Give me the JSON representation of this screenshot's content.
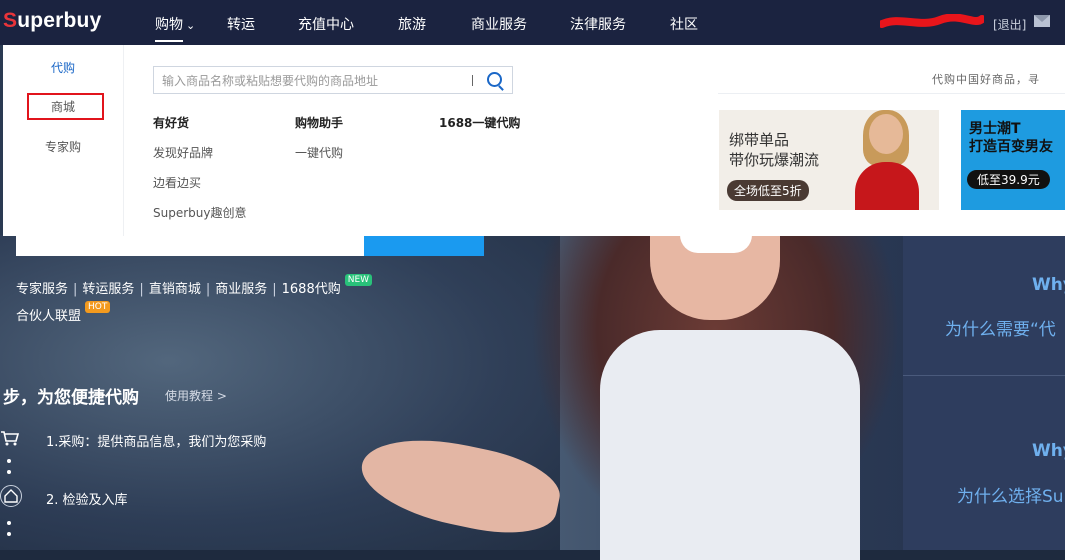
{
  "header": {
    "logo_s": "S",
    "logo_rest": "uperbuy",
    "nav": [
      "购物",
      "转运",
      "充值中心",
      "旅游",
      "商业服务",
      "法律服务",
      "社区"
    ],
    "logout": "[退出]"
  },
  "dropdown": {
    "side_items": [
      "代购",
      "商城",
      "专家购"
    ],
    "search_placeholder": "输入商品名称或粘贴想要代购的商品地址",
    "columns": [
      {
        "head": "有好货",
        "items": [
          "发现好品牌",
          "边看边买",
          "Superbuy趣创意"
        ]
      },
      {
        "head": "购物助手",
        "items": [
          "一键代购"
        ]
      },
      {
        "head": "1688一键代购",
        "items": []
      }
    ],
    "slogan": "代购中国好商品，寻",
    "banner1": {
      "line1": "绑带单品",
      "line2": "带你玩爆潮流",
      "tag": "全场低至5折"
    },
    "banner2": {
      "line1": "男士潮T",
      "line2": "打造百变男友",
      "tag": "低至39.9元"
    }
  },
  "hero": {
    "services": [
      "专家服务",
      "转运服务",
      "直销商城",
      "商业服务",
      "1688代购"
    ],
    "badge_new": "NEW",
    "partner": "合伙人联盟",
    "badge_hot": "HOT",
    "steps_title": "步，为您便捷代购",
    "tutorial": "使用教程 >",
    "steps": [
      "1.采购：提供商品信息，我们为您采购",
      "2. 检验及入库"
    ],
    "why1": "Why",
    "why1_sub": "为什么需要“代",
    "why2": "Why",
    "why2_sub": "为什么选择Su"
  }
}
